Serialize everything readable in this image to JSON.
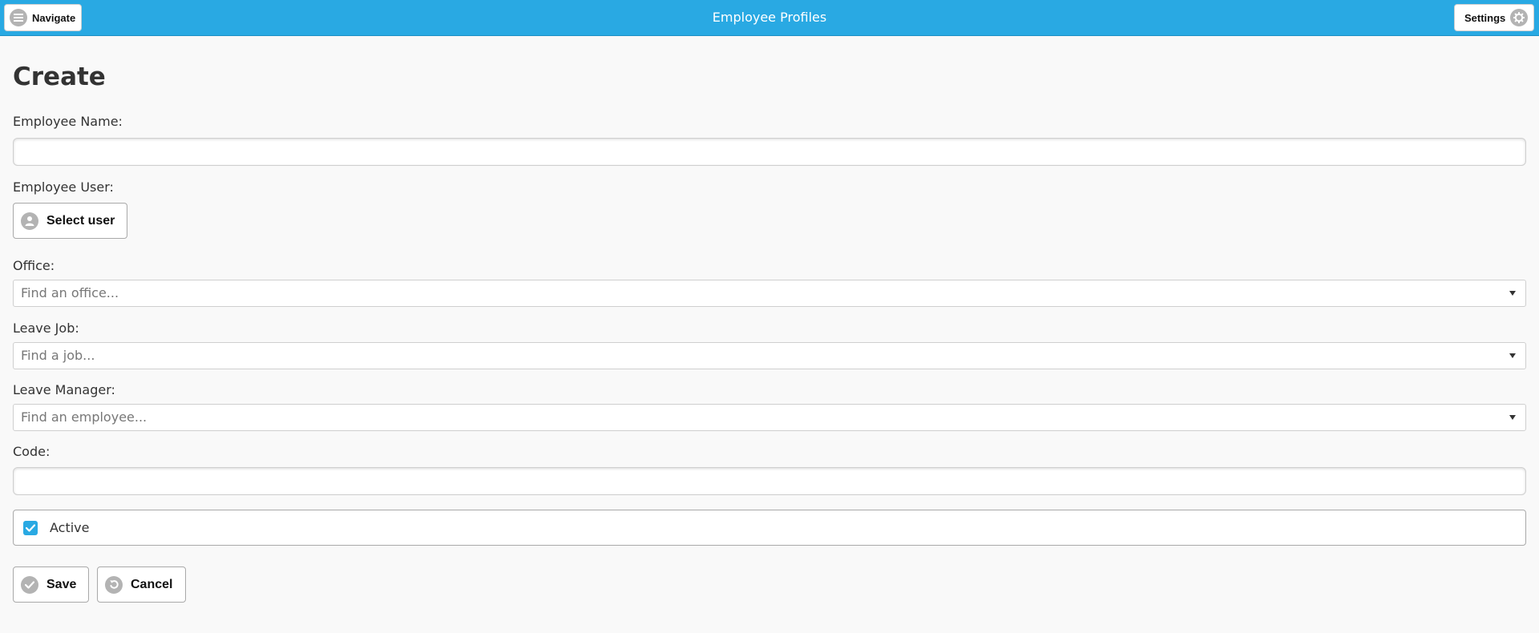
{
  "header": {
    "title": "Employee Profiles",
    "navigate_label": "Navigate",
    "settings_label": "Settings",
    "accent_color": "#29a9e3"
  },
  "page": {
    "title": "Create"
  },
  "form": {
    "employee_name": {
      "label": "Employee Name:",
      "value": ""
    },
    "employee_user": {
      "label": "Employee User:",
      "button_label": "Select user",
      "icon": "user-icon"
    },
    "office": {
      "label": "Office:",
      "placeholder": "Find an office..."
    },
    "leave_job": {
      "label": "Leave Job:",
      "placeholder": "Find a job..."
    },
    "leave_manager": {
      "label": "Leave Manager:",
      "placeholder": "Find an employee..."
    },
    "code": {
      "label": "Code:",
      "value": ""
    },
    "active": {
      "label": "Active",
      "checked": true
    }
  },
  "actions": {
    "save_label": "Save",
    "cancel_label": "Cancel"
  }
}
